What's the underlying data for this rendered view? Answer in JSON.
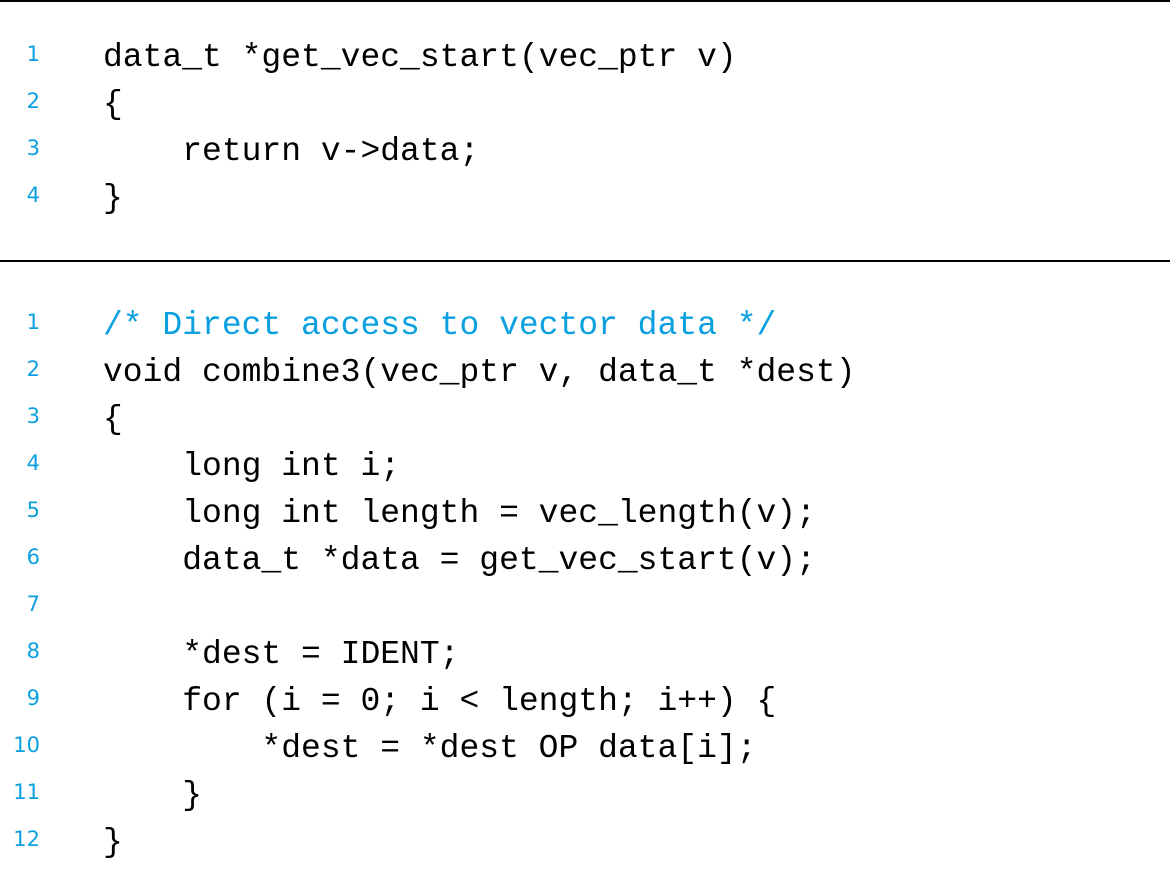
{
  "listing1": {
    "lines": [
      {
        "num": "1",
        "code": "data_t *get_vec_start(vec_ptr v)"
      },
      {
        "num": "2",
        "code": "{"
      },
      {
        "num": "3",
        "code": "    return v->data;"
      },
      {
        "num": "4",
        "code": "}"
      }
    ]
  },
  "listing2": {
    "lines": [
      {
        "num": "1",
        "code": "/* Direct access to vector data */"
      },
      {
        "num": "2",
        "code": "void combine3(vec_ptr v, data_t *dest)"
      },
      {
        "num": "3",
        "code": "{"
      },
      {
        "num": "4",
        "code": "    long int i;"
      },
      {
        "num": "5",
        "code": "    long int length = vec_length(v);"
      },
      {
        "num": "6",
        "code": "    data_t *data = get_vec_start(v);"
      },
      {
        "num": "7",
        "code": ""
      },
      {
        "num": "8",
        "code": "    *dest = IDENT;"
      },
      {
        "num": "9",
        "code": "    for (i = 0; i < length; i++) {"
      },
      {
        "num": "10",
        "code": "        *dest = *dest OP data[i];"
      },
      {
        "num": "11",
        "code": "    }"
      },
      {
        "num": "12",
        "code": "}"
      }
    ]
  },
  "colors": {
    "line_number": "#0aa0e0",
    "comment": "#0aa0e0",
    "code": "#000000",
    "rule": "#000000"
  }
}
